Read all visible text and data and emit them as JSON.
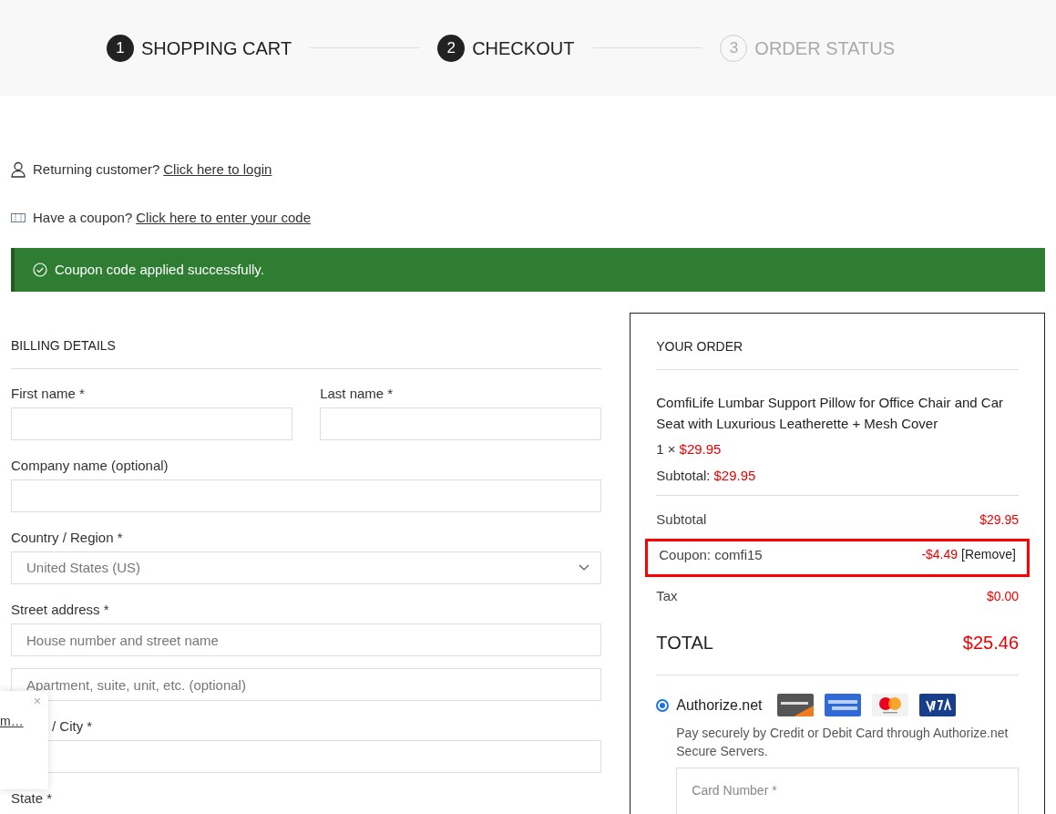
{
  "steps": [
    {
      "number": "1",
      "label": "SHOPPING CART",
      "active": true
    },
    {
      "number": "2",
      "label": "CHECKOUT",
      "active": true
    },
    {
      "number": "3",
      "label": "ORDER STATUS",
      "active": false
    }
  ],
  "notices": [
    {
      "kind": "user",
      "text": "Returning customer?",
      "link": "Click here to login"
    },
    {
      "kind": "coupon",
      "text": "Have a coupon?",
      "link": "Click here to enter your code"
    }
  ],
  "alert": {
    "text": "Coupon code applied successfully."
  },
  "billing": {
    "title": "BILLING DETAILS",
    "rows": [
      [
        {
          "kind": "text",
          "label": "First name *"
        },
        {
          "kind": "text",
          "label": "Last name *"
        }
      ],
      [
        {
          "kind": "text",
          "label": "Company name (optional)"
        }
      ],
      [
        {
          "kind": "select",
          "label": "Country / Region *",
          "value": "United States (US)"
        }
      ],
      [
        {
          "kind": "text",
          "label": "Street address *",
          "placeholder": "House number and street name"
        }
      ],
      [
        {
          "kind": "text",
          "placeholder": "Apartment, suite, unit, etc. (optional)"
        }
      ],
      [
        {
          "kind": "text",
          "label": "/ City *"
        }
      ],
      [
        {
          "kind": "label",
          "label": "State *"
        }
      ]
    ]
  },
  "order": {
    "title": "YOUR ORDER",
    "product": "ComfiLife Lumbar Support Pillow for Office Chair and Car Seat with Luxurious Leatherette + Mesh Cover",
    "quantity": "1 ×",
    "price": "$29.95",
    "subtotal_label": "Subtotal:",
    "subtotal": "$29.95",
    "rows": [
      {
        "label": "Subtotal",
        "value": "$29.95",
        "highlighted": false
      },
      {
        "label": "Coupon: comfi15",
        "value": "-$4.49",
        "action": "[Remove]",
        "highlighted": true
      },
      {
        "label": "Tax",
        "value": "$0.00",
        "highlighted": false
      }
    ],
    "total_label": "TOTAL",
    "total": "$25.46",
    "payment": {
      "label": "Authorize.net",
      "selected": true,
      "description": "Pay securely by Credit or Debit Card through Authorize.net Secure Servers.",
      "card_placeholder": "Card Number *"
    }
  },
  "popup": {
    "link": "m…",
    "close": "×"
  }
}
